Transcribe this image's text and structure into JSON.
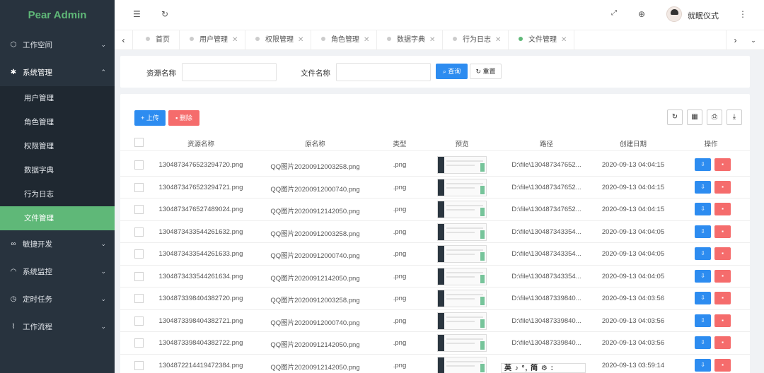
{
  "app": {
    "title": "Pear Admin"
  },
  "sidebar": {
    "items": [
      {
        "icon": "cube-icon",
        "label": "工作空间"
      },
      {
        "icon": "gear-icon",
        "label": "系统管理"
      },
      {
        "icon": "link-icon",
        "label": "敏捷开发"
      },
      {
        "icon": "gauge-icon",
        "label": "系统监控"
      },
      {
        "icon": "clock-icon",
        "label": "定时任务"
      },
      {
        "icon": "flow-icon",
        "label": "工作流程"
      }
    ],
    "sub_items": [
      "用户管理",
      "角色管理",
      "权限管理",
      "数据字典",
      "行为日志",
      "文件管理"
    ]
  },
  "header": {
    "user": "就眠仪式"
  },
  "tabs": [
    "首页",
    "用户管理",
    "权限管理",
    "角色管理",
    "数据字典",
    "行为日志",
    "文件管理"
  ],
  "search": {
    "resource_label": "资源名称",
    "resource_value": "",
    "file_label": "文件名称",
    "file_value": "",
    "query_btn": "查询",
    "reset_btn": "重置"
  },
  "toolbar": {
    "upload_btn": "上传",
    "delete_btn": "删除"
  },
  "table": {
    "columns": [
      "资源名称",
      "原名称",
      "类型",
      "预览",
      "路径",
      "创建日期",
      "操作"
    ],
    "rows": [
      [
        "1304873476523294720.png",
        "QQ图片20200912003258.png",
        ".png",
        "D:\\file\\130487347652...",
        "2020-09-13 04:04:15"
      ],
      [
        "1304873476523294721.png",
        "QQ图片20200912000740.png",
        ".png",
        "D:\\file\\130487347652...",
        "2020-09-13 04:04:15"
      ],
      [
        "1304873476527489024.png",
        "QQ图片20200912142050.png",
        ".png",
        "D:\\file\\130487347652...",
        "2020-09-13 04:04:15"
      ],
      [
        "1304873433544261632.png",
        "QQ图片20200912003258.png",
        ".png",
        "D:\\file\\130487343354...",
        "2020-09-13 04:04:05"
      ],
      [
        "1304873433544261633.png",
        "QQ图片20200912000740.png",
        ".png",
        "D:\\file\\130487343354...",
        "2020-09-13 04:04:05"
      ],
      [
        "1304873433544261634.png",
        "QQ图片20200912142050.png",
        ".png",
        "D:\\file\\130487343354...",
        "2020-09-13 04:04:05"
      ],
      [
        "1304873398404382720.png",
        "QQ图片20200912003258.png",
        ".png",
        "D:\\file\\130487339840...",
        "2020-09-13 04:03:56"
      ],
      [
        "1304873398404382721.png",
        "QQ图片20200912000740.png",
        ".png",
        "D:\\file\\130487339840...",
        "2020-09-13 04:03:56"
      ],
      [
        "1304873398404382722.png",
        "QQ图片20200912142050.png",
        ".png",
        "D:\\file\\130487339840...",
        "2020-09-13 04:03:56"
      ],
      [
        "1304872214419472384.png",
        "QQ图片20200912142050.png",
        ".png",
        "",
        "2020-09-13 03:59:14"
      ]
    ]
  },
  "ime": {
    "text": "英 ♪ °, 简 ⚙ :"
  },
  "colors": {
    "sidebar_bg": "#28333e",
    "accent_green": "#5fb878",
    "primary_blue": "#2d8cf0",
    "danger_red": "#f56c6c"
  }
}
